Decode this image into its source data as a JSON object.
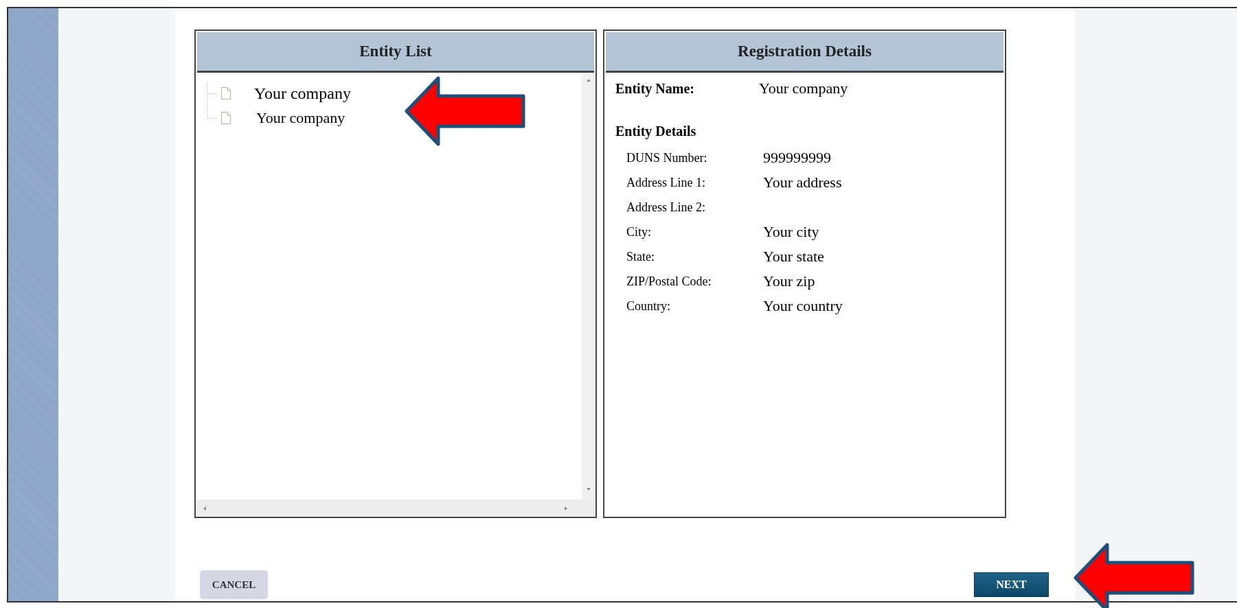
{
  "entity_list": {
    "title": "Entity List",
    "items": [
      {
        "name": "Your company"
      },
      {
        "name": "Your company"
      }
    ]
  },
  "registration_details": {
    "title": "Registration Details",
    "entity_name_label": "Entity Name:",
    "entity_name": "Your company",
    "section_title": "Entity Details",
    "fields": [
      {
        "label": "DUNS Number:",
        "value": "999999999"
      },
      {
        "label": "Address Line 1:",
        "value": "Your address"
      },
      {
        "label": "Address Line 2:"
      },
      {
        "label": "City:",
        "value": "Your city"
      },
      {
        "label": "State:",
        "value": "Your state"
      },
      {
        "label": "ZIP/Postal Code:",
        "value": "Your zip"
      },
      {
        "label": "Country:",
        "value": "Your country"
      }
    ]
  },
  "buttons": {
    "cancel": "CANCEL",
    "next": "NEXT"
  }
}
